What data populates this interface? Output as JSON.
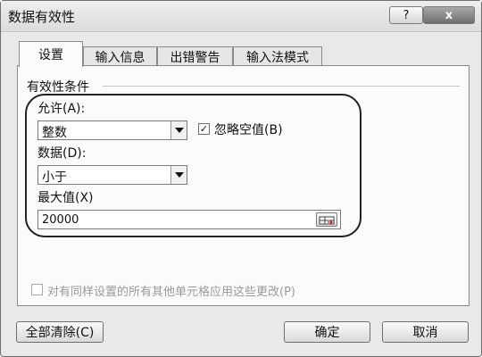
{
  "window": {
    "title": "数据有效性",
    "help_label": "?",
    "close_label": "x"
  },
  "tabs": [
    {
      "label": "设置",
      "active": true
    },
    {
      "label": "输入信息",
      "active": false
    },
    {
      "label": "出错警告",
      "active": false
    },
    {
      "label": "输入法模式",
      "active": false
    }
  ],
  "settings": {
    "group_label": "有效性条件",
    "allow_label": "允许(A):",
    "allow_value": "整数",
    "ignore_blank_label": "忽略空值(B)",
    "ignore_blank_checked": true,
    "data_label": "数据(D):",
    "data_value": "小于",
    "max_label": "最大值(X)",
    "max_value": "20000",
    "apply_all_label": "对有同样设置的所有其他单元格应用这些更改(P)",
    "apply_all_checked": false
  },
  "buttons": {
    "clear_all": "全部清除(C)",
    "ok": "确定",
    "cancel": "取消"
  }
}
